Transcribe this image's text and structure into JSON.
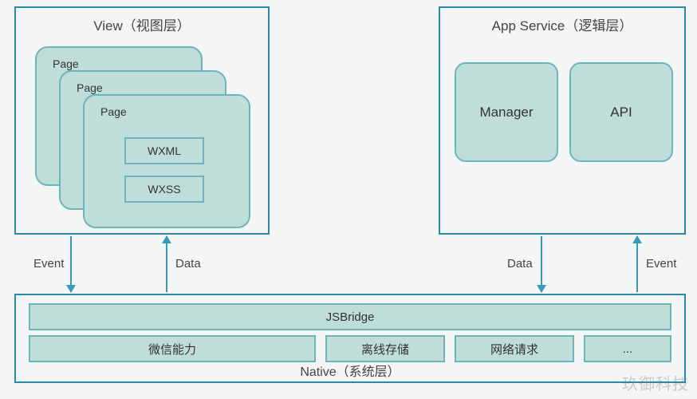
{
  "view": {
    "title": "View（视图层）",
    "page_label": "Page",
    "wxml": "WXML",
    "wxss": "WXSS"
  },
  "service": {
    "title": "App Service（逻辑层）",
    "manager": "Manager",
    "api": "API"
  },
  "native": {
    "title": "Native（系统层）",
    "jsbridge": "JSBridge",
    "cells": {
      "wechat": "微信能力",
      "storage": "离线存储",
      "network": "网络请求",
      "more": "..."
    }
  },
  "arrows": {
    "event": "Event",
    "data": "Data"
  },
  "watermark": "玖御科技"
}
